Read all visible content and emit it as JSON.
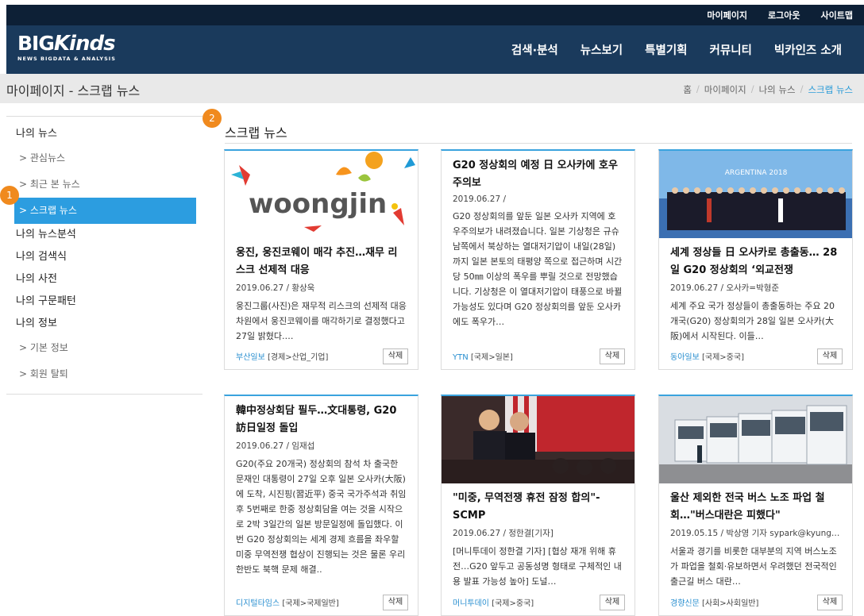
{
  "util_nav": [
    "마이페이지",
    "로그아웃",
    "사이트맵"
  ],
  "logo": {
    "main": "BIGKinds",
    "main_a": "BIG",
    "main_b": "Kinds",
    "sub": "NEWS BIGDATA & ANALYSIS"
  },
  "gnb": [
    "검색·분석",
    "뉴스보기",
    "특별기획",
    "커뮤니티",
    "빅카인즈 소개"
  ],
  "page_title": "마이페이지 - 스크랩 뉴스",
  "breadcrumb": [
    "홈",
    "마이페이지",
    "나의 뉴스",
    "스크랩 뉴스"
  ],
  "sidebar": {
    "my_news": "나의 뉴스",
    "interest": "> 관심뉴스",
    "recent": "> 최근 본 뉴스",
    "scrap": "> 스크랩 뉴스",
    "analysis": "나의 뉴스분석",
    "search": "나의 검색식",
    "dictionary": "나의 사전",
    "pattern": "나의 구문패턴",
    "info": "나의 정보",
    "basic": "> 기본 정보",
    "withdraw": "> 회원 탈퇴"
  },
  "badges": [
    "1",
    "2"
  ],
  "main_title": "스크랩 뉴스",
  "delete_label": "삭제",
  "cards": [
    {
      "title": "웅진, 웅진코웨이 매각 추진…재무 리스크 선제적 대응",
      "meta": "2019.06.27 / 황상욱",
      "summary": "웅진그룹(사진)은 재무적 리스크의 선제적 대응차원에서 웅진코웨이를 매각하기로 결정했다고 27일 밝혔다.…",
      "source": "부산일보",
      "category": "[경제>산업_기업]",
      "image": "woongjin-logo",
      "logo_text": "woongjin"
    },
    {
      "title": "G20 정상회의 예정 日 오사카에 호우주의보",
      "meta": "2019.06.27 /",
      "summary": "G20 정상회의를 앞둔 일본 오사카 지역에 호우주의보가 내려졌습니다. 일본 기상청은 규슈 남쪽에서 북상하는 열대저기압이 내일(28일)까지 일본 본토의 태평양 쪽으로 접근하며 시간당 50㎜ 이상의 폭우를 뿌릴 것으로 전망했습니다. 기상청은 이 열대저기압이 태풍으로 바뀔 가능성도 있다며 G20 정상회의를 앞둔 오사카에도 폭우가…",
      "source": "YTN",
      "category": "[국제>일본]",
      "image": "none"
    },
    {
      "title": "세계 정상들 日 오사카로 총출동… 28일 G20 정상회의 ‘외교전쟁",
      "meta": "2019.06.27 / 오사카=박형준",
      "summary": "세계 주요 국가 정상들이 총출동하는 주요 20개국(G20) 정상회의가 28일 일본 오사카(大阪)에서 시작된다. 이들…",
      "source": "동아일보",
      "category": "[국제>중국]",
      "image": "g20-group-photo",
      "photo_caption": "ARGENTINA 2018"
    },
    {
      "title": "韓中정상회담 필두…文대통령, G20 訪日일정 돌입",
      "meta": "2019.06.27 / 임재섭",
      "summary": "G20(주요 20개국) 정상회의 참석 차 출국한 문재인 대통령이 27일 오후 일본 오사카(大阪)에 도착, 시진핑(習近平) 중국 국가주석과 취임 후 5번째로 한중 정상회담을 여는 것을 시작으로 2박 3일간의 일본 방문일정에 돌입했다. 이번 G20 정상회의는 세계 경제 흐름을 좌우할 미중 무역전쟁 협상이 진행되는 것은 물론 우리 한반도 북핵 문제 해결..",
      "source": "디지털타임스",
      "category": "[국제>국제일반]",
      "image": "none"
    },
    {
      "title": "\"미중, 무역전쟁 휴전 잠정 합의\"- SCMP",
      "meta": "2019.06.27 / 정한결[기자]",
      "summary": "[머니투데이 정한결 기자] [협상 재개 위해 휴전…G20 앞두고 공동성명 형태로 구체적인 내용 발표 가능성 높아] 도널…",
      "source": "머니투데이",
      "category": "[국제>중국]",
      "image": "us-china-leaders"
    },
    {
      "title": "울산 제외한 전국 버스 노조 파업 철회…\"버스대란은 피했다\"",
      "meta": "2019.05.15 / 박상영 기자 sypark@kyung…",
      "summary": "서울과 경기를 비롯한 대부분의 지역 버스노조가 파업을 철회·유보하면서 우려했던 전국적인 출근길 버스 대란…",
      "source": "경향신문",
      "category": "[사회>사회일반]",
      "image": "bus-depot"
    }
  ],
  "colors": {
    "header": "#1a3a5c",
    "topbar": "#0d2036",
    "accent": "#2c9de0",
    "badge": "#f08a1e"
  }
}
